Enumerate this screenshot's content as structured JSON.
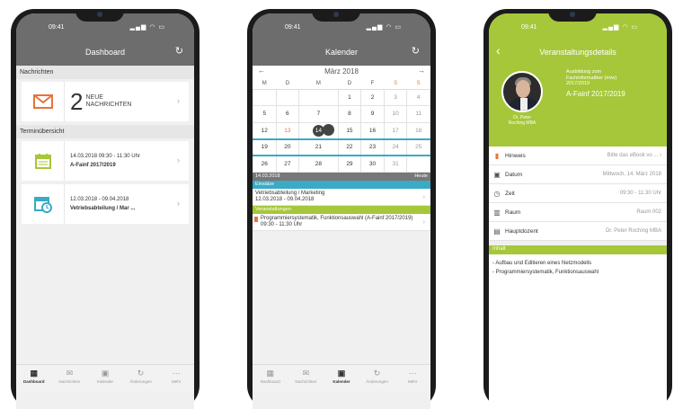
{
  "status": {
    "time": "09:41"
  },
  "dashboard": {
    "title": "Dashboard",
    "messages_section": "Nachrichten",
    "messages_count": "2",
    "messages_label_1": "NEUE",
    "messages_label_2": "NACHRICHTEN",
    "appointments_section": "Terminübersicht",
    "appointments": [
      {
        "date": "14.03.2018 09:30 - 11:30 Uhr",
        "title": "A-Fainf 2017/2019"
      },
      {
        "date": "12.03.2018 - 09.04.2018",
        "title": "Vetriebsabteilung / Mar ..."
      }
    ]
  },
  "calendar": {
    "title": "Kalender",
    "month": "März 2018",
    "weekdays": [
      "M",
      "D",
      "M",
      "D",
      "F",
      "S",
      "S"
    ],
    "weeks": [
      [
        "",
        "",
        "",
        "1",
        "2",
        "3",
        "4"
      ],
      [
        "5",
        "6",
        "7",
        "8",
        "9",
        "10",
        "11"
      ],
      [
        "12",
        "13",
        "14",
        "15",
        "16",
        "17",
        "18"
      ],
      [
        "19",
        "20",
        "21",
        "22",
        "23",
        "24",
        "25"
      ],
      [
        "26",
        "27",
        "28",
        "29",
        "30",
        "31",
        ""
      ]
    ],
    "selected_date": "14.03.2018",
    "today_label": "Heute",
    "einsaetze_label": "Einsätze",
    "einsatz_title": "Vetriebsabteilung / Marketing",
    "einsatz_date": "12.03.2018 - 09.04.2018",
    "veranstaltungen_label": "Veranstaltungen",
    "veranstaltung_title": "Programmiersystematik, Funktionsauswahl (A-Fainf 2017/2019)",
    "veranstaltung_time": "09:30 - 11:30 Uhr",
    "colors": {
      "einsaetze": "#3aaac5",
      "veranstaltungen": "#a6c739"
    }
  },
  "details": {
    "title": "Veranstaltungsdetails",
    "course_line1": "Ausbildung zum",
    "course_line2": "Fachinformatiker (m/w)",
    "course_line3": "2017/2019",
    "course_code": "A-Fainf 2017/2019",
    "person_line1": "Dr. Peter",
    "person_line2": "Roching MBA",
    "rows": [
      {
        "label": "Hinweis",
        "value": "Bitte das eBook vo ...  ›"
      },
      {
        "label": "Datum",
        "value": "Mittwoch, 14. März 2018"
      },
      {
        "label": "Zeit",
        "value": "09:30 - 11:30 Uhr"
      },
      {
        "label": "Raum",
        "value": "Raum 002"
      },
      {
        "label": "Hauptdozent",
        "value": "Dr. Peter Roching MBA"
      }
    ],
    "inhalt_label": "Inhalt",
    "inhalt_1": "- Aufbau und Editieren eines Netzmodells",
    "inhalt_2": "- Programmiersystematik, Funktionsauswahl"
  },
  "tabs": [
    "Dashboard",
    "Nachrichten",
    "Kalender",
    "Änderungen",
    "Mehr"
  ],
  "colors": {
    "accent_orange": "#e8733a",
    "accent_green": "#a6c739",
    "accent_blue": "#3aaac5"
  }
}
